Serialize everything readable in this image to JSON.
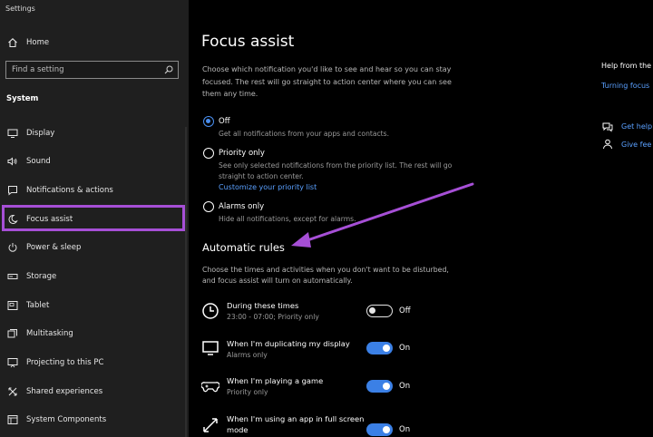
{
  "window": {
    "title": "Settings"
  },
  "sidebar": {
    "home_label": "Home",
    "search_placeholder": "Find a setting",
    "section_label": "System",
    "items": [
      {
        "label": "Display",
        "icon": "monitor-icon"
      },
      {
        "label": "Sound",
        "icon": "speaker-icon"
      },
      {
        "label": "Notifications & actions",
        "icon": "notification-icon"
      },
      {
        "label": "Focus assist",
        "icon": "moon-icon",
        "selected": true
      },
      {
        "label": "Power & sleep",
        "icon": "power-icon"
      },
      {
        "label": "Storage",
        "icon": "storage-icon"
      },
      {
        "label": "Tablet",
        "icon": "tablet-icon"
      },
      {
        "label": "Multitasking",
        "icon": "multitasking-icon"
      },
      {
        "label": "Projecting to this PC",
        "icon": "projector-icon"
      },
      {
        "label": "Shared experiences",
        "icon": "shared-icon"
      },
      {
        "label": "System Components",
        "icon": "components-icon"
      }
    ]
  },
  "main": {
    "title": "Focus assist",
    "intro": [
      "Choose which notification you'd like to see and hear so you can stay",
      "focused. The rest will go straight to action center where you can see",
      "them any time."
    ],
    "options": [
      {
        "label": "Off",
        "desc": [
          "Get all notifications from your apps and contacts."
        ],
        "selected": true
      },
      {
        "label": "Priority only",
        "desc": [
          "See only selected notifications from the priority list. The rest will go",
          "straight to action center."
        ],
        "link": "Customize your priority list"
      },
      {
        "label": "Alarms only",
        "desc": [
          "Hide all notifications, except for alarms."
        ]
      }
    ],
    "automatic_rules": {
      "title": "Automatic rules",
      "desc": [
        "Choose the times and activities when you don't want to be disturbed,",
        "and focus assist will turn on automatically."
      ],
      "rules": [
        {
          "title": "During these times",
          "sub": "23:00 - 07:00; Priority only",
          "state": "Off",
          "on": false,
          "icon": "clock-icon"
        },
        {
          "title": "When I'm duplicating my display",
          "sub": "Alarms only",
          "state": "On",
          "on": true,
          "icon": "monitor-icon"
        },
        {
          "title": "When I'm playing a game",
          "sub": "Priority only",
          "state": "On",
          "on": true,
          "icon": "gamepad-icon"
        },
        {
          "title": "When I'm using an app in full screen",
          "title2": "mode",
          "state": "On",
          "on": true,
          "icon": "fullscreen-icon"
        }
      ]
    }
  },
  "help": {
    "title": "Help from the",
    "link1": "Turning focus",
    "link2": "Get help",
    "link3": "Give fee"
  },
  "colors": {
    "accent": "#3b80e6",
    "highlight": "#a64fd6",
    "link": "#5aa0ff"
  }
}
